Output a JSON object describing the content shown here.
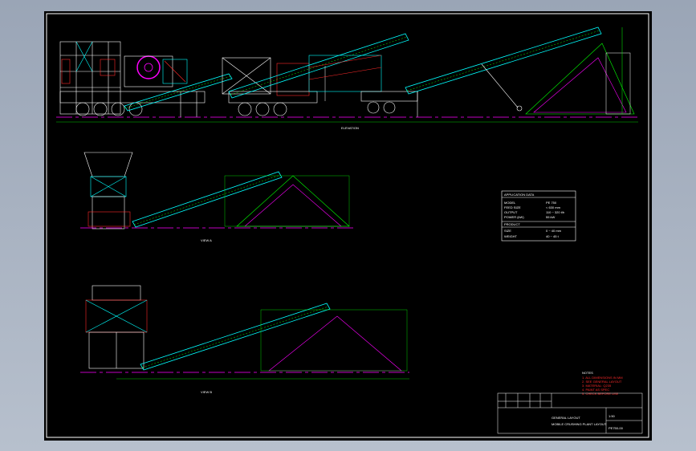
{
  "colors": {
    "background": "#000000",
    "border": "#ffffff",
    "structure": "#ffffff",
    "cyan": "#00ffff",
    "green": "#00ff00",
    "magenta": "#ff00ff",
    "red": "#ff2a2a",
    "yellow": "#ffff00",
    "blue": "#4060ff"
  },
  "views": {
    "elevation": "ELEVATION",
    "side_view_1": "VIEW A",
    "side_view_2": "VIEW B"
  },
  "spec_table": {
    "title": "APPLICATION DATA",
    "rows": [
      {
        "k": "MODEL",
        "v": "PE 750"
      },
      {
        "k": "FEED SIZE",
        "v": "< 630 mm"
      },
      {
        "k": "OUTPUT",
        "v": "110 ~ 320 t/h"
      },
      {
        "k": "POWER (kW)",
        "v": "55 kW"
      }
    ],
    "sub_title": "PRODUCT",
    "sub_rows": [
      {
        "k": "SIZE",
        "v": "0 ~ 40 mm"
      },
      {
        "k": "WEIGHT",
        "v": "40 ~ 45 t"
      }
    ]
  },
  "notes": {
    "title": "NOTES",
    "lines": [
      "1. ALL DIMENSIONS IN MM",
      "2. SEE GENERAL LAYOUT",
      "3. MATERIAL: Q235",
      "4. PAINT AS SPEC",
      "5. CHECK BEFORE USE"
    ]
  },
  "title_block": {
    "company": "GENERAL LAYOUT",
    "drawing_title": "MOBILE CRUSHING PLANT LAYOUT",
    "drawing_no": "PE750-00",
    "scale": "1:50"
  }
}
